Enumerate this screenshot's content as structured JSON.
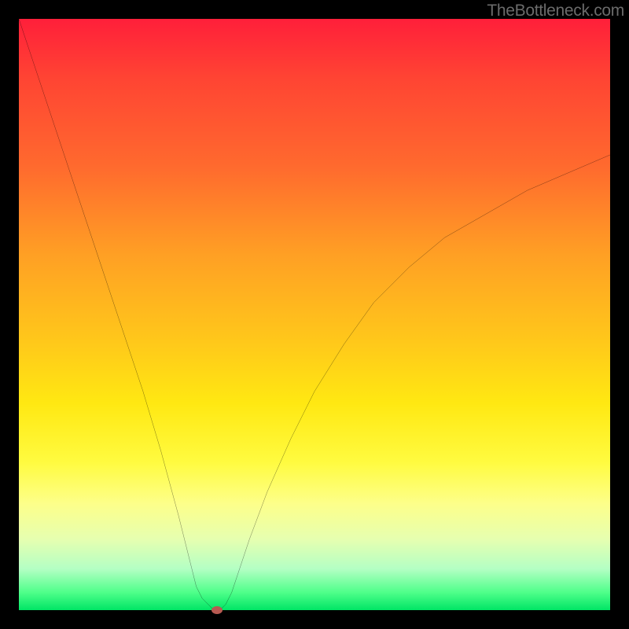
{
  "watermark": "TheBottleneck.com",
  "chart_data": {
    "type": "line",
    "title": "",
    "xlabel": "",
    "ylabel": "",
    "xlim": [
      0,
      100
    ],
    "ylim": [
      0,
      100
    ],
    "grid": false,
    "legend": false,
    "background_gradient": {
      "top": "#ff1f3a",
      "mid": "#ffe812",
      "bottom": "#00e565"
    },
    "series": [
      {
        "name": "bottleneck-curve",
        "color": "#000000",
        "x": [
          0,
          3,
          6,
          9,
          12,
          15,
          18,
          21,
          24,
          27,
          30,
          31,
          32,
          33,
          34,
          35,
          36,
          37,
          39,
          42,
          46,
          50,
          55,
          60,
          66,
          72,
          79,
          86,
          93,
          100
        ],
        "y": [
          100,
          91,
          82,
          73,
          64,
          55,
          46,
          37,
          27,
          16,
          4,
          2,
          1,
          0,
          0,
          1,
          3,
          6,
          12,
          20,
          29,
          37,
          45,
          52,
          58,
          63,
          67,
          71,
          74,
          77
        ]
      }
    ],
    "marker": {
      "name": "optimal-point",
      "x": 33.5,
      "y": 0,
      "color": "#b85a52"
    }
  }
}
